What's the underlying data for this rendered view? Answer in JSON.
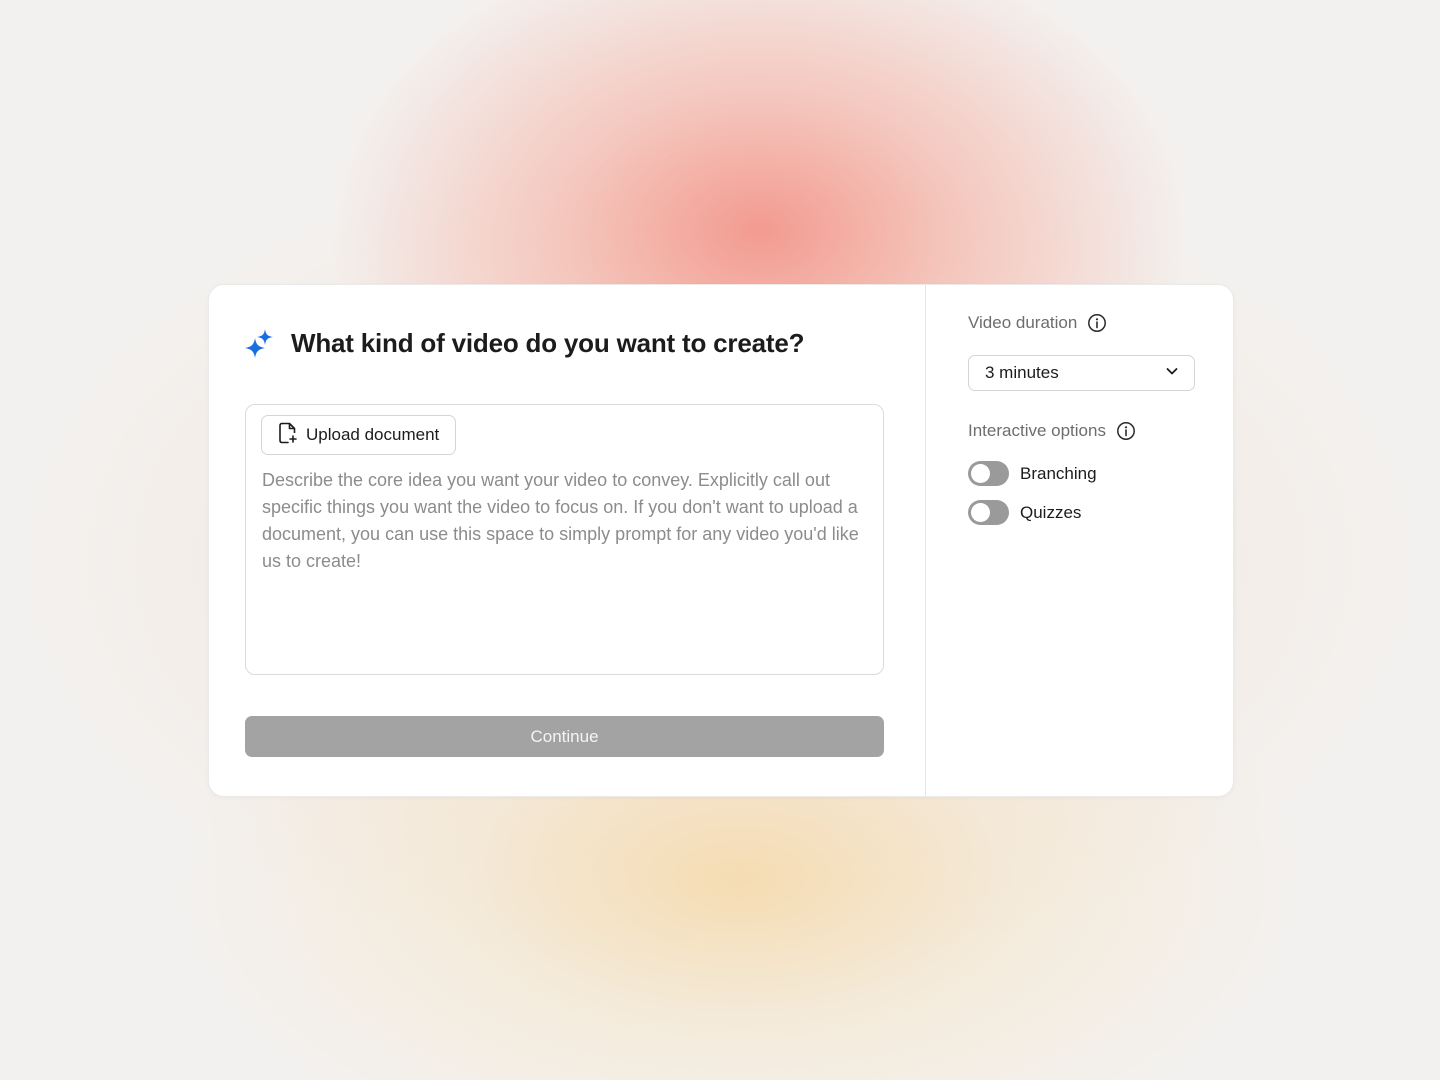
{
  "main": {
    "title": "What kind of video do you want to create?",
    "upload_label": "Upload document",
    "prompt_placeholder": "Describe the core idea you want your video to convey. Explicitly call out specific things you want the video to focus on. If you don't want to upload a document, you can use this space to simply prompt for any video you'd like us to create!",
    "continue_label": "Continue"
  },
  "settings": {
    "duration_label": "Video duration",
    "duration_value": "3 minutes",
    "interactive_label": "Interactive options",
    "toggles": [
      {
        "label": "Branching",
        "on": false
      },
      {
        "label": "Quizzes",
        "on": false
      }
    ]
  },
  "icons": {
    "sparkle": "sparkle-icon",
    "upload": "file-plus-icon",
    "info": "info-icon",
    "chevron": "chevron-down-icon"
  },
  "colors": {
    "accent": "#1a6fe0",
    "continue_disabled": "#a3a3a3",
    "toggle_off": "#9a9a9a"
  }
}
